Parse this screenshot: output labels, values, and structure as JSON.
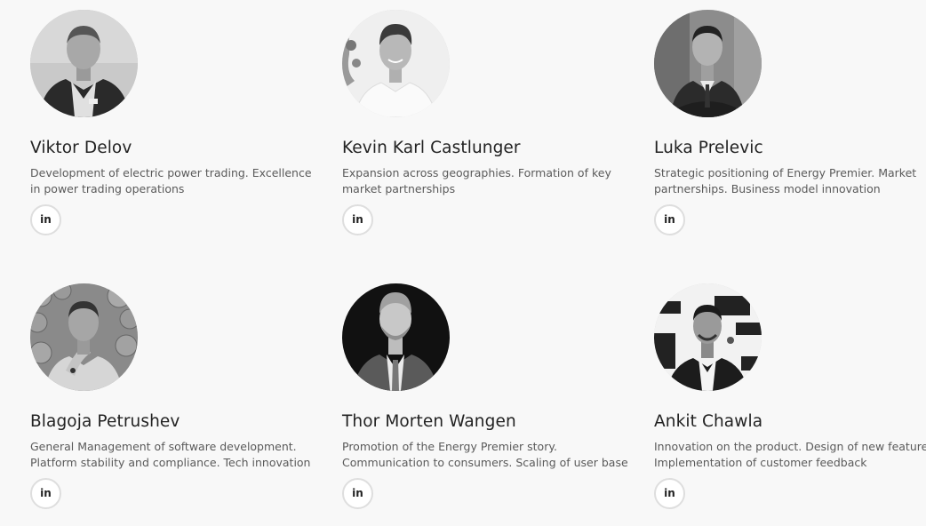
{
  "team": [
    {
      "name": "Viktor Delov",
      "desc_line1": "Development of electric power trading. Excellence",
      "desc_line2": "in power trading operations",
      "linkedin_label": "in",
      "photo_icon": "person-portrait"
    },
    {
      "name": "Kevin Karl Castlunger",
      "desc_line1": "Expansion across geographies. Formation of key",
      "desc_line2": "market partnerships",
      "linkedin_label": "in",
      "photo_icon": "person-portrait"
    },
    {
      "name": "Luka Prelevic",
      "desc_line1": "Strategic positioning of Energy Premier. Market",
      "desc_line2": "partnerships. Business model innovation",
      "linkedin_label": "in",
      "photo_icon": "person-portrait"
    },
    {
      "name": "Blagoja Petrushev",
      "desc_line1": "General Management of software development.",
      "desc_line2": "Platform stability and compliance. Tech innovation",
      "linkedin_label": "in",
      "photo_icon": "person-portrait"
    },
    {
      "name": "Thor Morten Wangen",
      "desc_line1": "Promotion of the Energy Premier story.",
      "desc_line2": "Communication to consumers. Scaling of user base",
      "linkedin_label": "in",
      "photo_icon": "person-portrait"
    },
    {
      "name": "Ankit Chawla",
      "desc_line1": "Innovation on the product. Design of new features.",
      "desc_line2": "Implementation of customer feedback",
      "linkedin_label": "in",
      "photo_icon": "person-portrait"
    }
  ],
  "colors": {
    "background": "#f8f8f8",
    "name_text": "#222222",
    "desc_text": "#5a5a5a",
    "button_border": "#dedede"
  }
}
